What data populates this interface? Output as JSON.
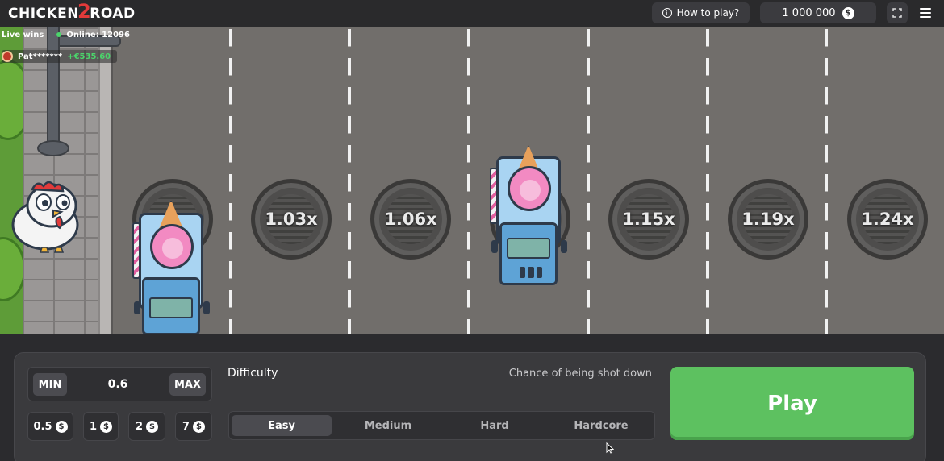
{
  "header": {
    "logo_left": "CHICKEN",
    "logo_number": "2",
    "logo_right": "ROAD",
    "how_to_play_label": "How to play?",
    "balance": "1 000 000",
    "currency_symbol": "$"
  },
  "live": {
    "live_wins_label": "Live wins",
    "online_label": "Online: 12096",
    "last_win": {
      "player": "Pat*******",
      "amount": "+€535.60"
    }
  },
  "lanes": [
    {
      "multiplier": ""
    },
    {
      "multiplier": "1.03x"
    },
    {
      "multiplier": "1.06x"
    },
    {
      "multiplier": ""
    },
    {
      "multiplier": "1.15x"
    },
    {
      "multiplier": "1.19x"
    },
    {
      "multiplier": "1.24x"
    }
  ],
  "bet": {
    "min_label": "MIN",
    "max_label": "MAX",
    "value": "0.6",
    "quick_amounts": [
      "0.5",
      "1",
      "2",
      "7"
    ]
  },
  "difficulty": {
    "label": "Difficulty",
    "chance_label": "Chance of being shot down",
    "options": [
      "Easy",
      "Medium",
      "Hard",
      "Hardcore"
    ],
    "selected": "Easy"
  },
  "play_label": "Play",
  "colors": {
    "play_button": "#5dc160",
    "win_amount": "#4bd56b",
    "road": "#716e6b",
    "panel": "#3a3a3d"
  },
  "icons": [
    "info-icon",
    "dollar-coin-icon",
    "fullscreen-icon",
    "menu-icon",
    "online-dot-icon"
  ]
}
